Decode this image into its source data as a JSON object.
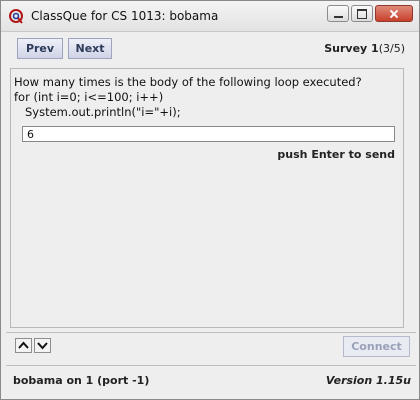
{
  "window": {
    "title": "ClassQue for CS 1013: bobama",
    "icon": "classque-q-icon"
  },
  "nav": {
    "prev_label": "Prev",
    "next_label": "Next",
    "survey_label": "Survey 1",
    "survey_count": "(3/5)"
  },
  "question": {
    "text": "How many times is the body of the following loop executed?\nfor (int i=0; i<=100; i++)\n   System.out.println(\"i=\"+i);"
  },
  "answer": {
    "value": "6",
    "hint": "push Enter to send"
  },
  "controls": {
    "up_icon": "chevron-up-icon",
    "down_icon": "chevron-down-icon",
    "connect_label": "Connect"
  },
  "status": {
    "left": "bobama on 1 (port -1)",
    "version": "Version 1.15u"
  },
  "colors": {
    "button_text": "#2d3c5a",
    "button_bg": "#cfd3e6",
    "close_button": "#c7402b"
  }
}
